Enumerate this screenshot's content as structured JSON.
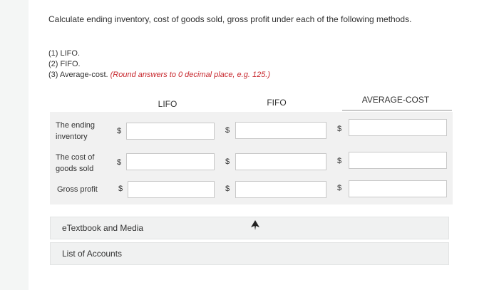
{
  "instructions": "Calculate ending inventory, cost of goods sold, gross profit under each of the following methods.",
  "methods": [
    {
      "text": "(1) LIFO.",
      "note": ""
    },
    {
      "text": "(2) FIFO.",
      "note": ""
    },
    {
      "text": "(3) Average-cost. ",
      "note": "(Round answers to 0 decimal place, e.g. 125.)"
    }
  ],
  "table": {
    "columns": [
      "LIFO",
      "FIFO",
      "AVERAGE-COST"
    ],
    "currency_symbol": "$",
    "rows": [
      {
        "label_line1": "The ending",
        "label_line2": "inventory",
        "values": [
          "",
          "",
          ""
        ]
      },
      {
        "label_line1": "The cost of",
        "label_line2": "goods sold",
        "values": [
          "",
          "",
          ""
        ]
      },
      {
        "label_line1": "Gross profit",
        "label_line2": "",
        "values": [
          "",
          "",
          ""
        ]
      }
    ]
  },
  "links": {
    "etextbook": "eTextbook and Media",
    "accounts": "List of Accounts"
  },
  "icons": {
    "cursor": "pointer-cursor-icon"
  },
  "colors": {
    "note_red": "#c7272d"
  }
}
